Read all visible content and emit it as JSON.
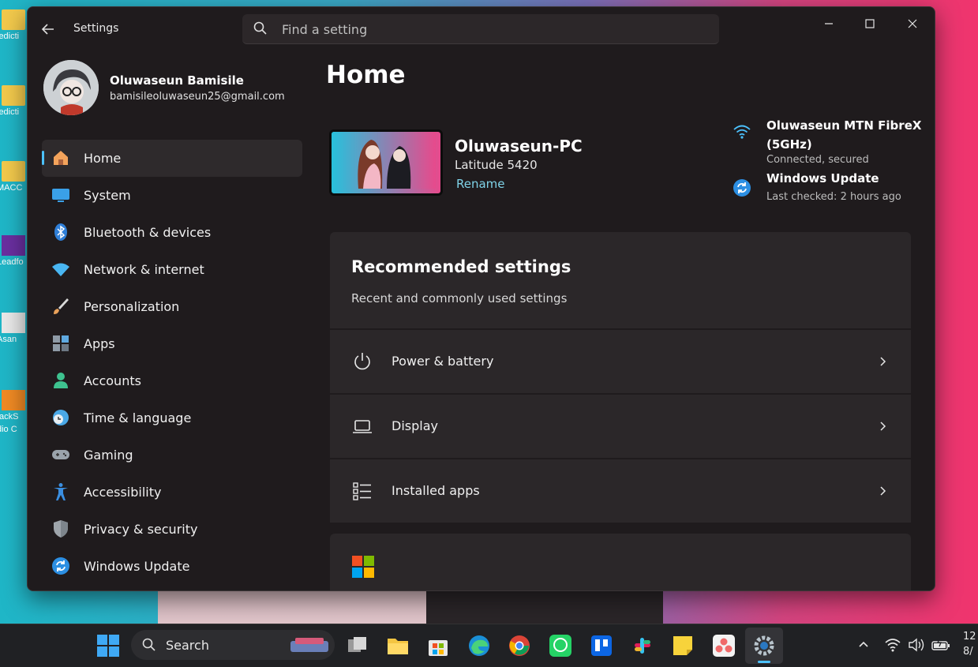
{
  "window": {
    "title": "Settings"
  },
  "search": {
    "placeholder": "Find a setting"
  },
  "profile": {
    "name": "Oluwaseun Bamisile",
    "email": "bamisileoluwaseun25@gmail.com"
  },
  "nav": {
    "items": [
      {
        "label": "Home",
        "icon": "home-icon"
      },
      {
        "label": "System",
        "icon": "monitor-icon"
      },
      {
        "label": "Bluetooth & devices",
        "icon": "bluetooth-icon"
      },
      {
        "label": "Network & internet",
        "icon": "wifi-icon"
      },
      {
        "label": "Personalization",
        "icon": "brush-icon"
      },
      {
        "label": "Apps",
        "icon": "apps-icon"
      },
      {
        "label": "Accounts",
        "icon": "account-icon"
      },
      {
        "label": "Time & language",
        "icon": "clock-globe-icon"
      },
      {
        "label": "Gaming",
        "icon": "gamepad-icon"
      },
      {
        "label": "Accessibility",
        "icon": "accessibility-icon"
      },
      {
        "label": "Privacy & security",
        "icon": "shield-icon"
      },
      {
        "label": "Windows Update",
        "icon": "update-icon"
      }
    ],
    "active_index": 0
  },
  "main": {
    "title": "Home",
    "device": {
      "name": "Oluwaseun-PC",
      "model": "Latitude 5420",
      "rename": "Rename"
    },
    "network": {
      "name": "Oluwaseun MTN FibreX (5GHz)",
      "status": "Connected, secured"
    },
    "update": {
      "name": "Windows Update",
      "status": "Last checked: 2 hours ago"
    },
    "recommended": {
      "title": "Recommended settings",
      "subtitle": "Recent and commonly used settings",
      "items": [
        {
          "label": "Power & battery",
          "icon": "power-icon"
        },
        {
          "label": "Display",
          "icon": "laptop-icon"
        },
        {
          "label": "Installed apps",
          "icon": "list-icon"
        }
      ]
    }
  },
  "taskbar": {
    "search_label": "Search",
    "clock_time": "12",
    "clock_date": "8/"
  },
  "desktop": {
    "labels": [
      "ledicti",
      "ledicti",
      "MACC",
      "Leadfo",
      "Asan",
      "tackS",
      "dio C"
    ]
  },
  "colors": {
    "accent": "#4cc2ff",
    "link": "#7fd3e8",
    "window_bg": "#1f1b1d",
    "card_bg": "#2b2729"
  }
}
